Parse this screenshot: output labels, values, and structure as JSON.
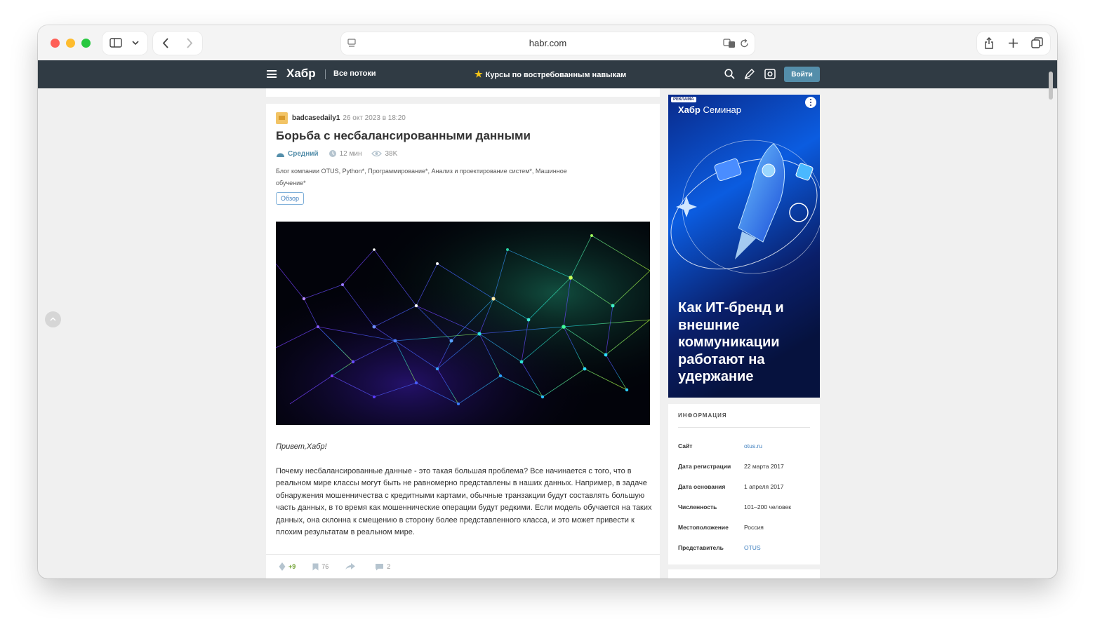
{
  "browser": {
    "url": "habr.com"
  },
  "header": {
    "logo": "Хабр",
    "flows": "Все потоки",
    "promo": "Курсы по востребованным навыкам",
    "login": "Войти"
  },
  "article": {
    "author": "badcasedaily1",
    "date": "26 окт 2023 в 18:20",
    "title": "Борьба с несбалансированными данными",
    "level": "Средний",
    "read_time": "12 мин",
    "views": "38K",
    "hubs": "Блог компании OTUS, Python*, Программирование*, Анализ и проектирование систем*, Машинное обучение*",
    "badge": "Обзор",
    "greeting": "Привет,Хабр!",
    "paragraph": "Почему несбалансированные данные - это такая большая проблема? Все начинается с того, что в реальном мире классы могут быть не равномерно представлены в наших данных. Например, в задаче обнаружения мошенничества с кредитными картами, обычные транзакции будут составлять большую часть данных, в то время как мошеннические операции будут редкими. Если модель обучается на таких данных, она склонна к смещению в сторону более представленного класса, и это может привести к плохим результатам в реальном мире.",
    "score": "+9",
    "bookmarks": "76",
    "comments": "2"
  },
  "ad": {
    "label": "РЕКЛАМА",
    "brand_bold": "Хабр",
    "brand_rest": "Семинар",
    "headline": "Как ИТ-бренд и внешние коммуникации работают на удержание"
  },
  "info": {
    "heading": "ИНФОРМАЦИЯ",
    "rows": [
      {
        "key": "Сайт",
        "value": "otus.ru"
      },
      {
        "key": "Дата регистрации",
        "value": "22 марта 2017"
      },
      {
        "key": "Дата основания",
        "value": "1 апреля 2017"
      },
      {
        "key": "Численность",
        "value": "101–200 человек"
      },
      {
        "key": "Местоположение",
        "value": "Россия"
      },
      {
        "key": "Представитель",
        "value": "OTUS"
      }
    ]
  },
  "colors": {
    "header_bg": "#303b44",
    "login_bg": "#548eaa",
    "link": "#3d7ebe",
    "score": "#6c9f2b"
  }
}
